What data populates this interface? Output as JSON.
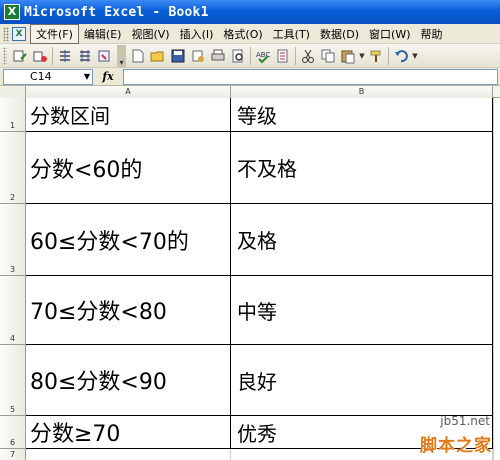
{
  "window": {
    "title": "Microsoft Excel - Book1",
    "app_icon_glyph": "X"
  },
  "menubar": {
    "items": [
      {
        "label": "文件(F)"
      },
      {
        "label": "编辑(E)"
      },
      {
        "label": "视图(V)"
      },
      {
        "label": "插入(I)"
      },
      {
        "label": "格式(O)"
      },
      {
        "label": "工具(T)"
      },
      {
        "label": "数据(D)"
      },
      {
        "label": "窗口(W)"
      },
      {
        "label": "帮助"
      }
    ]
  },
  "toolbar": {
    "icons": [
      "track-changes-icon",
      "reply-icon",
      "shrink-icon",
      "expand-icon",
      "review-icon",
      "new-document-icon",
      "open-folder-icon",
      "save-icon",
      "permission-icon",
      "print-icon",
      "print-preview-icon",
      "spelling-icon",
      "research-icon",
      "cut-icon",
      "copy-icon",
      "paste-icon",
      "format-painter-icon",
      "undo-icon"
    ]
  },
  "formula_bar": {
    "name_box": "C14",
    "fx_label": "fx",
    "formula": ""
  },
  "sheet": {
    "columns": [
      "A",
      "B"
    ],
    "rows": [
      {
        "num": "1",
        "a": "分数区间",
        "b": "等级"
      },
      {
        "num": "2",
        "a": "分数<60的",
        "b": "不及格"
      },
      {
        "num": "3",
        "a": "60≤分数<70的",
        "b": "及格"
      },
      {
        "num": "4",
        "a": "70≤分数<80",
        "b": "中等"
      },
      {
        "num": "5",
        "a": "80≤分数<90",
        "b": "良好"
      },
      {
        "num": "6",
        "a": "分数≥70",
        "b": "优秀"
      },
      {
        "num": "7",
        "a": "",
        "b": ""
      }
    ]
  },
  "watermark": {
    "url": "jb51.net",
    "logo": "脚本之家"
  },
  "colors": {
    "titlebar": "#0a5fd6",
    "chrome": "#ece9d8",
    "watermark": "#e07b1a"
  }
}
